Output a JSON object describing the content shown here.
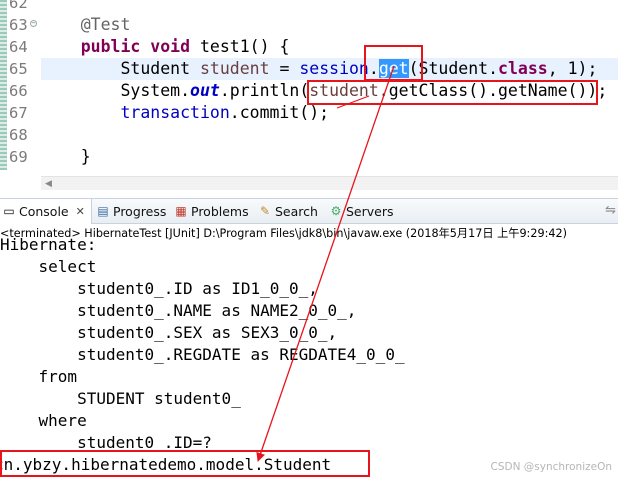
{
  "editor": {
    "line_numbers": [
      "62",
      "63",
      "64",
      "65",
      "66",
      "67",
      "68",
      "69"
    ],
    "lines": {
      "annotation": "@Test",
      "public_kw": "public",
      "void_kw": "void",
      "method_sig": " test1() {",
      "student_type": "Student",
      "student_var": "student",
      "eq": " = ",
      "session_field": "session",
      "dot": ".",
      "get_call": "get",
      "get_args_open": "(Student.",
      "class_kw": "class",
      "get_args_close": ", 1);",
      "system": "System.",
      "out_field": "out",
      "println_open": ".println(",
      "student_ref": "student",
      "getclass_chain": ".getClass().getName());",
      "transaction_field": "transaction",
      "commit": ".commit();",
      "close_brace": "}"
    }
  },
  "views": {
    "tabs": [
      {
        "label": "Console",
        "icon": "console-icon",
        "active": true
      },
      {
        "label": "Progress",
        "icon": "progress-icon"
      },
      {
        "label": "Problems",
        "icon": "problems-icon"
      },
      {
        "label": "Search",
        "icon": "search-icon"
      },
      {
        "label": "Servers",
        "icon": "servers-icon"
      }
    ],
    "close_glyph": "✕"
  },
  "console": {
    "header": "<terminated> HibernateTest [JUnit] D:\\Program Files\\jdk8\\bin\\javaw.exe (2018年5月17日 上午9:29:42)",
    "output": [
      "Hibernate:",
      "    select",
      "        student0_.ID as ID1_0_0_,",
      "        student0_.NAME as NAME2_0_0_,",
      "        student0_.SEX as SEX3_0_0_,",
      "        student0_.REGDATE as REGDATE4_0_0_",
      "    from",
      "        STUDENT student0_",
      "    where",
      "        student0_.ID=?",
      "cn.ybzy.hibernatedemo.model.Student"
    ]
  },
  "watermark": "CSDN @synchronizeOn",
  "colors": {
    "keyword": "#7f0055",
    "field": "#0000c0",
    "selection": "#3399ff",
    "annotation_red": "#e8141c",
    "current_line": "#e8f2fe"
  }
}
